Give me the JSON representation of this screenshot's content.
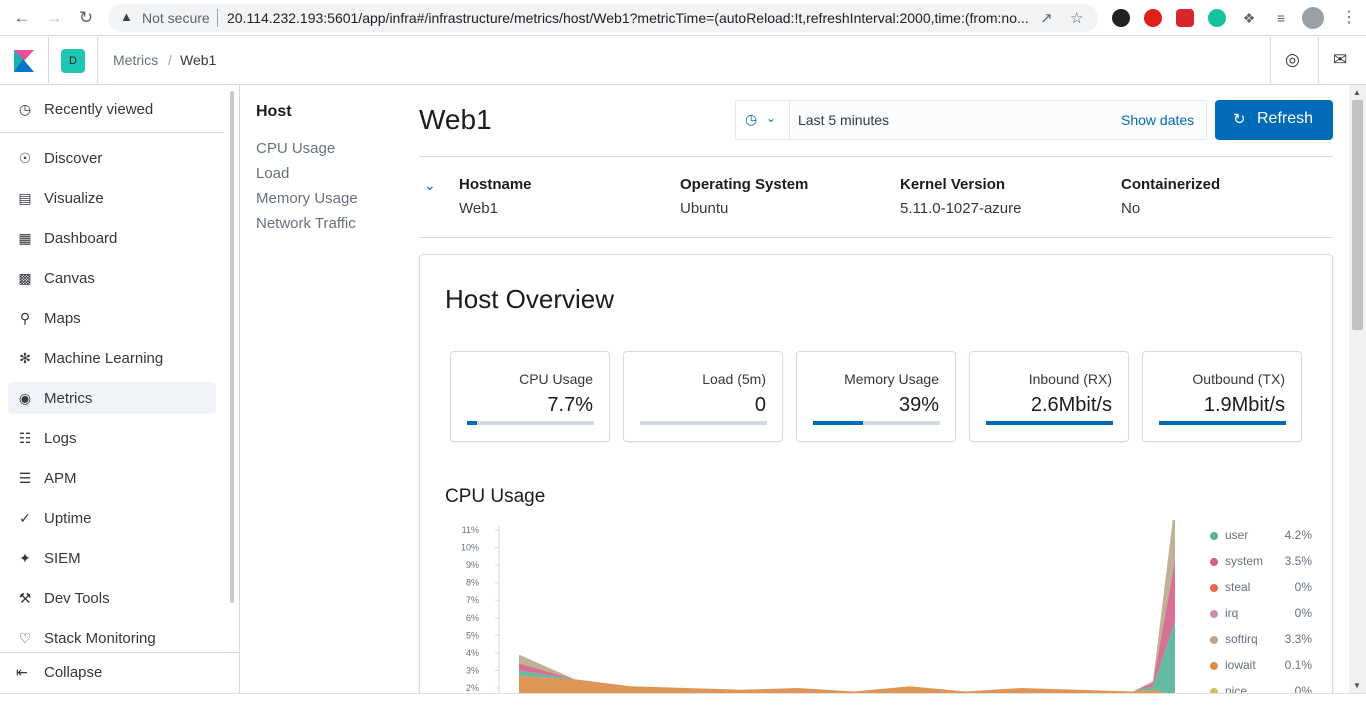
{
  "browser": {
    "not_secure": "Not secure",
    "url": "20.114.232.193:5601/app/infra#/infrastructure/metrics/host/Web1?metricTime=(autoReload:!t,refreshInterval:2000,time:(from:no..."
  },
  "header": {
    "space_initial": "D",
    "breadcrumb_parent": "Metrics",
    "breadcrumb_separator": "/",
    "breadcrumb_current": "Web1"
  },
  "sidebar": {
    "recently_viewed": "Recently viewed",
    "items": [
      {
        "label": "Discover",
        "icon": "compass-icon"
      },
      {
        "label": "Visualize",
        "icon": "visualize-icon"
      },
      {
        "label": "Dashboard",
        "icon": "dashboard-icon"
      },
      {
        "label": "Canvas",
        "icon": "canvas-icon"
      },
      {
        "label": "Maps",
        "icon": "maps-icon"
      },
      {
        "label": "Machine Learning",
        "icon": "machine-learning-icon"
      },
      {
        "label": "Metrics",
        "icon": "metrics-icon"
      },
      {
        "label": "Logs",
        "icon": "logs-icon"
      },
      {
        "label": "APM",
        "icon": "apm-icon"
      },
      {
        "label": "Uptime",
        "icon": "uptime-icon"
      },
      {
        "label": "SIEM",
        "icon": "siem-icon"
      },
      {
        "label": "Dev Tools",
        "icon": "dev-tools-icon"
      },
      {
        "label": "Stack Monitoring",
        "icon": "stack-monitoring-icon"
      }
    ],
    "active_item": "Metrics",
    "collapse": "Collapse"
  },
  "subnav": {
    "title": "Host",
    "links": [
      "CPU Usage",
      "Load",
      "Memory Usage",
      "Network Traffic"
    ]
  },
  "page": {
    "title": "Web1",
    "time_range": "Last 5 minutes",
    "show_dates": "Show dates",
    "refresh": "Refresh"
  },
  "metadata": [
    {
      "label": "Hostname",
      "value": "Web1"
    },
    {
      "label": "Operating System",
      "value": "Ubuntu"
    },
    {
      "label": "Kernel Version",
      "value": "5.11.0-1027-azure"
    },
    {
      "label": "Containerized",
      "value": "No"
    }
  ],
  "overview": {
    "title": "Host Overview",
    "cards": [
      {
        "label": "CPU Usage",
        "value": "7.7%",
        "fill": 0.077
      },
      {
        "label": "Load (5m)",
        "value": "0",
        "fill": 0
      },
      {
        "label": "Memory Usage",
        "value": "39%",
        "fill": 0.39
      },
      {
        "label": "Inbound (RX)",
        "value": "2.6Mbit/s",
        "fill": 1.0
      },
      {
        "label": "Outbound (TX)",
        "value": "1.9Mbit/s",
        "fill": 1.0
      }
    ]
  },
  "cpu_section": {
    "title": "CPU Usage"
  },
  "chart_data": {
    "type": "area",
    "title": "CPU Usage",
    "y_ticks": [
      "11%",
      "10%",
      "9%",
      "8%",
      "7%",
      "6%",
      "5%",
      "4%",
      "3%",
      "2%"
    ],
    "ylim": [
      2,
      11
    ],
    "stacked": true,
    "series": [
      {
        "name": "user",
        "color": "#54b399",
        "legend_value": "4.2%",
        "values": [
          0.3,
          0,
          0,
          0,
          0,
          0,
          0,
          0,
          0,
          0,
          0,
          0,
          0.2,
          4.2
        ]
      },
      {
        "name": "system",
        "color": "#d36086",
        "legend_value": "3.5%",
        "values": [
          0.4,
          0,
          0,
          0,
          0,
          0,
          0,
          0,
          0,
          0,
          0,
          0,
          0.2,
          3.5
        ]
      },
      {
        "name": "steal",
        "color": "#e7664c",
        "legend_value": "0%",
        "values": [
          0,
          0,
          0,
          0,
          0,
          0,
          0,
          0,
          0,
          0,
          0,
          0,
          0,
          0
        ]
      },
      {
        "name": "irq",
        "color": "#ca8eae",
        "legend_value": "0%",
        "values": [
          0,
          0,
          0,
          0,
          0,
          0,
          0,
          0,
          0,
          0,
          0,
          0,
          0,
          0
        ]
      },
      {
        "name": "softirq",
        "color": "#b9a888",
        "legend_value": "3.3%",
        "values": [
          0.5,
          0,
          0,
          0,
          0,
          0,
          0,
          0,
          0,
          0,
          0,
          0,
          0.1,
          3.3
        ]
      },
      {
        "name": "iowait",
        "color": "#da8b45",
        "legend_value": "0.1%",
        "values": [
          1.2,
          1.0,
          0.6,
          0.5,
          0.4,
          0.5,
          0.3,
          0.6,
          0.3,
          0.5,
          0.4,
          0.3,
          0.4,
          0.1
        ]
      },
      {
        "name": "nice",
        "color": "#d6bf57",
        "legend_value": "0%",
        "values": [
          0,
          0,
          0,
          0,
          0,
          0,
          0,
          0,
          0,
          0,
          0,
          0,
          0,
          0
        ]
      }
    ]
  }
}
